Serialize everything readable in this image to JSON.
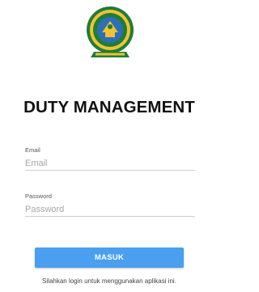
{
  "logo": {
    "icon": "institution-emblem-logo",
    "colors": {
      "outer_ring": "#1f7d3a",
      "inner_ring": "#f2c230",
      "center": "#2c6fb8",
      "ribbon": "#1f7d3a"
    }
  },
  "app": {
    "title": "DUTY MANAGEMENT"
  },
  "form": {
    "email": {
      "label": "Email",
      "placeholder": "Email",
      "value": ""
    },
    "password": {
      "label": "Password",
      "placeholder": "Password",
      "value": ""
    },
    "submit_label": "MASUK",
    "submit_color": "#4a9ff0"
  },
  "footer": {
    "hint": "Silahkan login untuk menggunakan aplikasi ini."
  }
}
